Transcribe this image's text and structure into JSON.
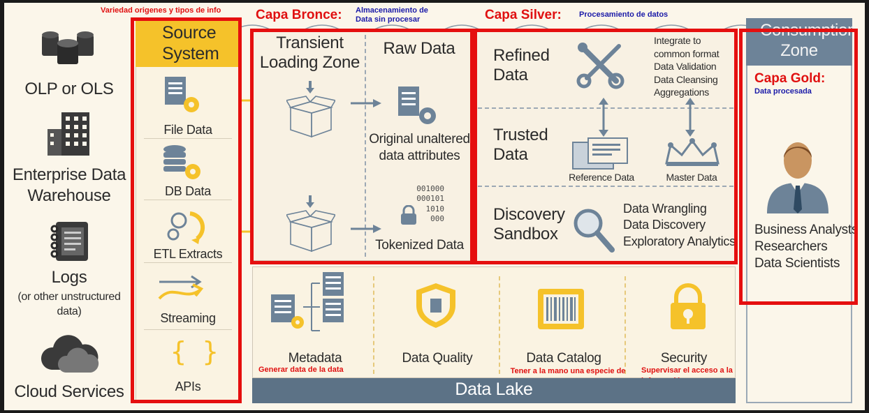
{
  "left_sources": [
    {
      "label": "OLP or OLS",
      "icon": "database-cluster-icon"
    },
    {
      "label": "Enterprise Data Warehouse",
      "icon": "building-icon"
    },
    {
      "label": "Logs",
      "sub": "(or other unstructured data)",
      "icon": "notebook-icon"
    },
    {
      "label": "Cloud Services",
      "icon": "cloud-icon"
    }
  ],
  "source_system": {
    "title": "Source System",
    "note": "Variedad origenes y tipos de info",
    "items": [
      "File Data",
      "DB Data",
      "ETL Extracts",
      "Streaming",
      "APIs"
    ]
  },
  "bronze": {
    "title": "Capa Bronce:",
    "note": "Almacenamiento de Data sin procesar",
    "transient": "Transient Loading Zone",
    "raw": "Raw Data",
    "original": "Original unaltered data attributes",
    "binary": "001000\n000101\n1010\n000",
    "tokenized": "Tokenized Data"
  },
  "silver": {
    "title": "Capa Silver:",
    "note": "Procesamiento de datos",
    "refined": "Refined Data",
    "refined_list": [
      "Integrate to common format",
      "Data Validation",
      "Data Cleansing",
      "Aggregations"
    ],
    "trusted": "Trusted Data",
    "reference": "Reference Data",
    "master": "Master Data",
    "discovery": "Discovery Sandbox",
    "discovery_list": [
      "Data Wrangling",
      "Data Discovery",
      "Exploratory Analytics"
    ]
  },
  "gold": {
    "zone": "Consumption Zone",
    "title": "Capa Gold:",
    "note": "Data procesada",
    "users": [
      "Business Analysts",
      "Researchers",
      "Data Scientists"
    ]
  },
  "governance": [
    {
      "label": "Metadata",
      "note": "Generar data de la data"
    },
    {
      "label": "Data Quality",
      "note": ""
    },
    {
      "label": "Data Catalog",
      "note": "Tener a la mano una especie de indices de la info."
    },
    {
      "label": "Security",
      "note": "Supervisar el acceso a la información"
    }
  ],
  "data_lake": "Data Lake",
  "colors": {
    "red": "#e50f0f",
    "gold": "#f5c22a",
    "slate": "#6d8398",
    "lake": "#5c7286",
    "note_blue": "#1a1aa8"
  }
}
